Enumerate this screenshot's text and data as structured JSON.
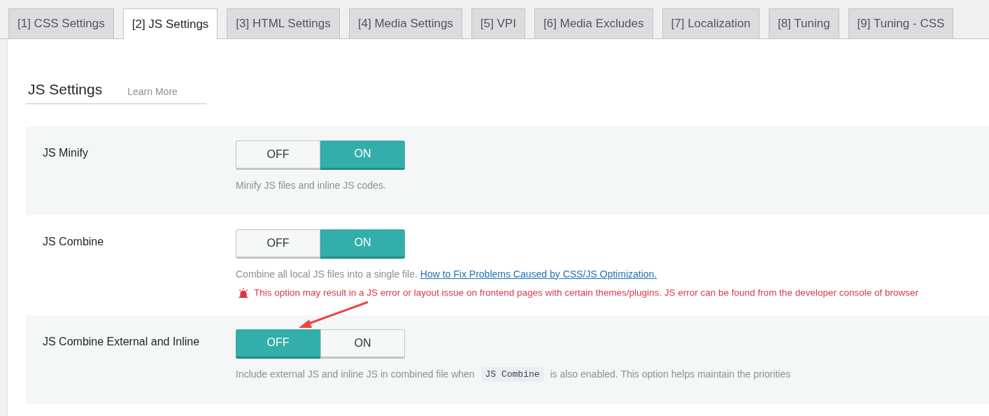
{
  "tabs": [
    {
      "label": "[1] CSS Settings",
      "selected": false
    },
    {
      "label": "[2] JS Settings",
      "selected": true
    },
    {
      "label": "[3] HTML Settings",
      "selected": false
    },
    {
      "label": "[4] Media Settings",
      "selected": false
    },
    {
      "label": "[5] VPI",
      "selected": false
    },
    {
      "label": "[6] Media Excludes",
      "selected": false
    },
    {
      "label": "[7] Localization",
      "selected": false
    },
    {
      "label": "[8] Tuning",
      "selected": false
    },
    {
      "label": "[9] Tuning - CSS",
      "selected": false
    }
  ],
  "heading": "JS Settings",
  "learn_more": "Learn More",
  "settings": [
    {
      "label": "JS Minify",
      "on": true,
      "off_label": "OFF",
      "on_label": "ON",
      "description": [
        {
          "kind": "text",
          "text": "Minify JS files and inline JS codes."
        }
      ]
    },
    {
      "label": "JS Combine",
      "on": true,
      "off_label": "OFF",
      "on_label": "ON",
      "description": [
        {
          "kind": "text",
          "text": "Combine all local JS files into a single file. "
        },
        {
          "kind": "link",
          "text": "How to Fix Problems Caused by CSS/JS Optimization."
        }
      ],
      "warning": "This option may result in a JS error or layout issue on frontend pages with certain themes/plugins. JS error can be found from the developer console of browser"
    },
    {
      "label": "JS Combine External and Inline",
      "on": false,
      "off_label": "OFF",
      "on_label": "ON",
      "description": [
        {
          "kind": "text",
          "text": "Include external JS and inline JS in combined file when "
        },
        {
          "kind": "code",
          "text": "JS Combine"
        },
        {
          "kind": "text",
          "text": " is also enabled. This option helps maintain the priorities"
        }
      ]
    }
  ]
}
